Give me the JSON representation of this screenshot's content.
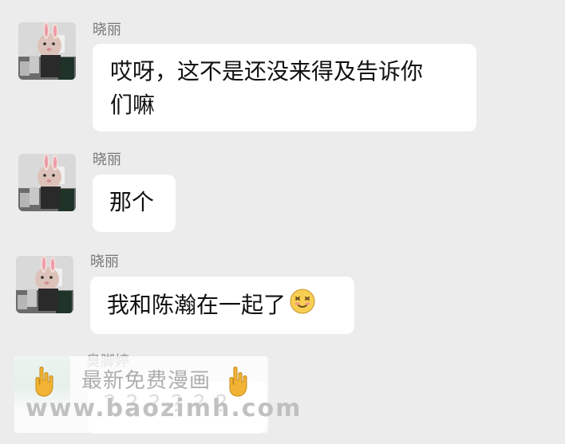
{
  "messages": [
    {
      "sender": "晓丽",
      "lines": [
        "哎呀，这不是还没来得及告诉你",
        "们嘛"
      ]
    },
    {
      "sender": "晓丽",
      "lines": [
        "那个"
      ]
    },
    {
      "sender": "晓丽",
      "lines": [
        "我和陈瀚在一起了"
      ]
    },
    {
      "sender": "臭脚婷",
      "lines": [
        "？？？？？？"
      ]
    }
  ],
  "watermark": {
    "title": "最新免费漫画",
    "url": "www.baozimh.com"
  },
  "emojis": {
    "message_3": "embarrassed-face-icon",
    "watermark_left": "pointing-down-hand-icon",
    "watermark_right": "pointing-down-hand-icon"
  }
}
